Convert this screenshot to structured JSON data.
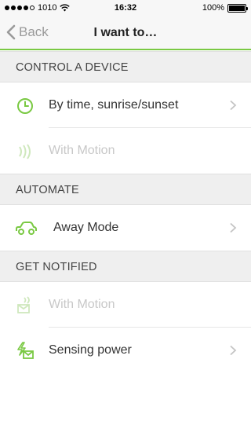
{
  "status_bar": {
    "carrier": "1010",
    "time": "16:32",
    "battery": "100%",
    "battery_level": 1.0
  },
  "nav": {
    "back_label": "Back",
    "title": "I want to…"
  },
  "sections": [
    {
      "title": "CONTROL A DEVICE",
      "items": [
        {
          "label": "By time, sunrise/sunset",
          "icon": "clock-icon",
          "enabled": true
        },
        {
          "label": "With Motion",
          "icon": "motion-waves-icon",
          "enabled": false
        }
      ]
    },
    {
      "title": "AUTOMATE",
      "items": [
        {
          "label": "Away Mode",
          "icon": "car-icon",
          "enabled": true
        }
      ]
    },
    {
      "title": "GET NOTIFIED",
      "items": [
        {
          "label": "With Motion",
          "icon": "motion-mail-icon",
          "enabled": false
        },
        {
          "label": "Sensing power",
          "icon": "power-mail-icon",
          "enabled": true
        }
      ]
    }
  ],
  "colors": {
    "accent": "#7ac943",
    "disabled": "#c8c8c8",
    "section_bg": "#efefef"
  }
}
